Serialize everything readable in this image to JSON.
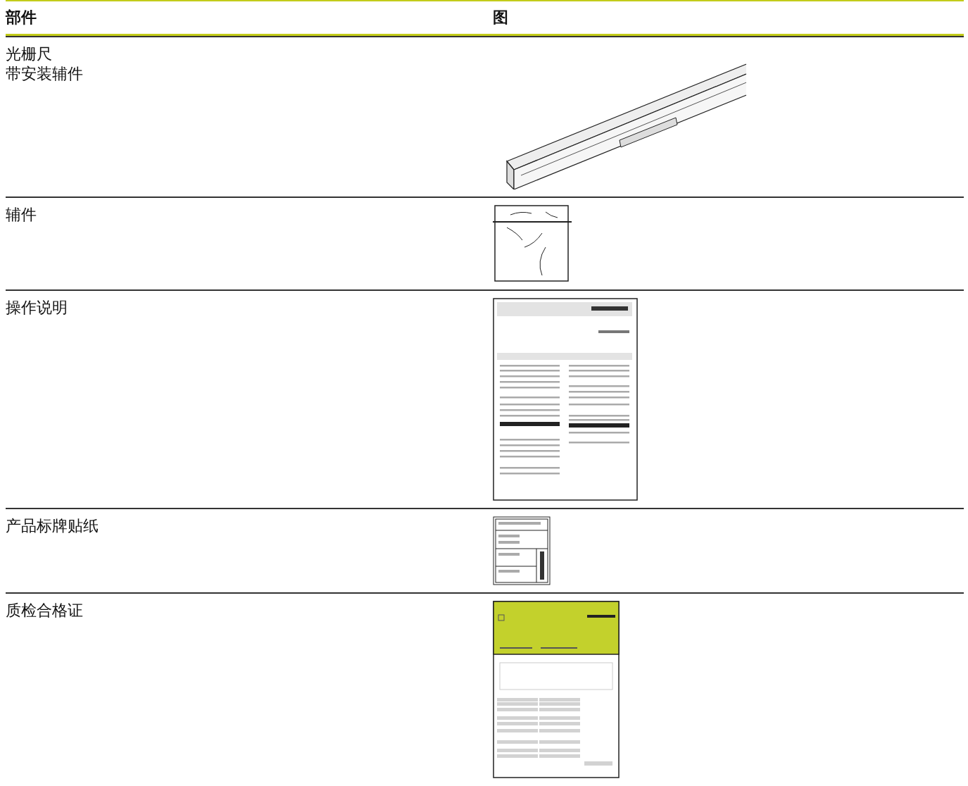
{
  "table": {
    "columns": [
      "部件",
      "图"
    ],
    "rows": [
      {
        "part": [
          "光栅尺",
          "带安装辅件"
        ],
        "kind": "scale"
      },
      {
        "part": [
          "辅件"
        ],
        "kind": "bag"
      },
      {
        "part": [
          "操作说明"
        ],
        "kind": "manual"
      },
      {
        "part": [
          "产品标牌贴纸"
        ],
        "kind": "label"
      },
      {
        "part": [
          "质检合格证"
        ],
        "kind": "certificate"
      }
    ]
  }
}
